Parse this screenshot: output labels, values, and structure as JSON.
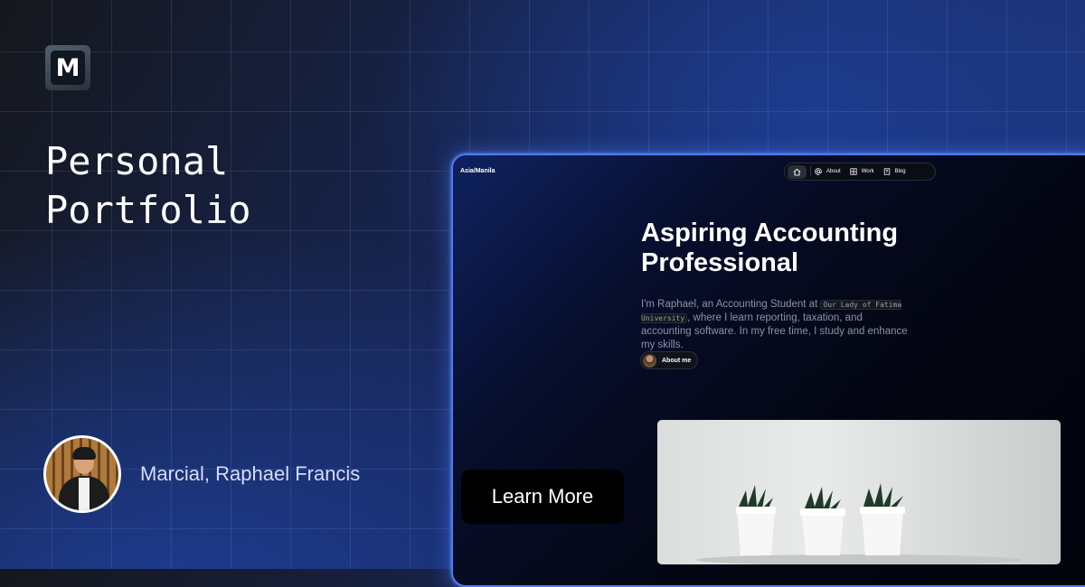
{
  "brand": {
    "logo_letter": "M"
  },
  "title": {
    "line1": "Personal",
    "line2": "Portfolio"
  },
  "author": {
    "name": "Marcial, Raphael Francis"
  },
  "preview": {
    "timezone": "Asia/Manila",
    "nav": {
      "about": "About",
      "work": "Work",
      "blog": "Blog"
    },
    "headline": {
      "line1": "Aspiring Accounting",
      "line2": "Professional"
    },
    "bio": {
      "before": "I'm Raphael, an Accounting Student at ",
      "school": "Our Lady of Fatima University",
      "after": ", where I learn reporting, taxation, and accounting software. In my free time, I study and enhance my skills."
    },
    "about_button": "About me"
  },
  "cta": {
    "label": "Learn More"
  },
  "colors": {
    "accent_border": "#4d7cf5",
    "page_bg": "#172554",
    "button_bg": "#000000"
  },
  "icons": [
    "home-icon",
    "at-sign-icon",
    "grid-icon",
    "book-icon"
  ]
}
